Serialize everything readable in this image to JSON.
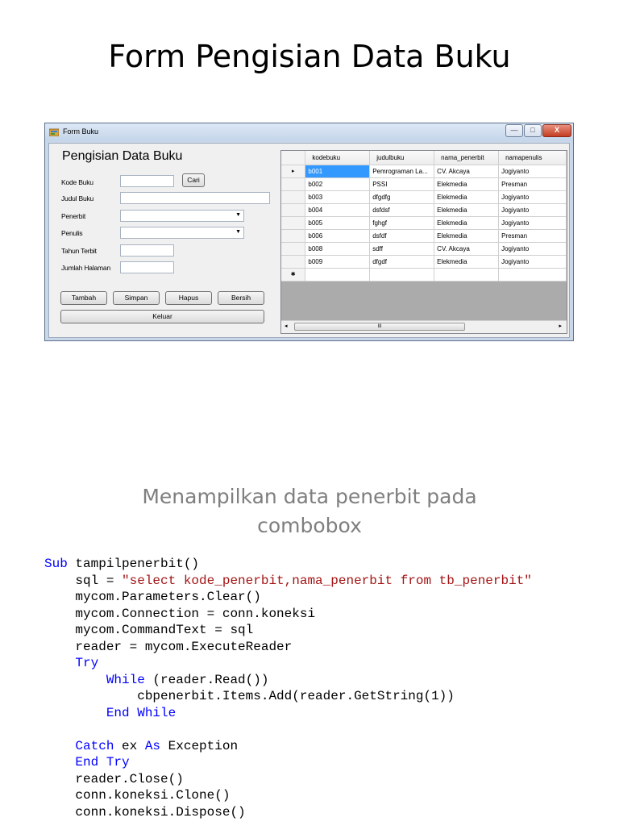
{
  "slide": {
    "title": "Form Pengisian Data Buku",
    "subtitle_line1": "Menampilkan data penerbit pada",
    "subtitle_line2": "combobox"
  },
  "window": {
    "title": "Form Buku",
    "controls": {
      "minimize": "—",
      "maximize": "□",
      "close": "X"
    }
  },
  "form": {
    "heading": "Pengisian Data Buku",
    "labels": {
      "kode_buku": "Kode Buku",
      "judul_buku": "Judul Buku",
      "penerbit": "Penerbit",
      "penulis": "Penulis",
      "tahun_terbit": "Tahun Terbit",
      "jumlah_halaman": "Jumlah Halaman"
    },
    "values": {
      "kode_buku": "",
      "judul_buku": "",
      "penerbit": "",
      "penulis": "",
      "tahun_terbit": "",
      "jumlah_halaman": ""
    },
    "buttons": {
      "cari": "Cari",
      "tambah": "Tambah",
      "simpan": "Simpan",
      "hapus": "Hapus",
      "bersih": "Bersih",
      "keluar": "Keluar"
    }
  },
  "grid": {
    "columns": [
      "kodebuku",
      "judulbuku",
      "nama_penerbit",
      "namapenulis"
    ],
    "rows": [
      [
        "b001",
        "Pemrograman La...",
        "CV. Akcaya",
        "Jogiyanto"
      ],
      [
        "b002",
        "PSSI",
        "Elekmedia",
        "Presman"
      ],
      [
        "b003",
        "dfgdfg",
        "Elekmedia",
        "Jogiyanto"
      ],
      [
        "b004",
        "dsfdsf",
        "Elekmedia",
        "Jogiyanto"
      ],
      [
        "b005",
        "fghgf",
        "Elekmedia",
        "Jogiyanto"
      ],
      [
        "b006",
        "dsfdf",
        "Elekmedia",
        "Presman"
      ],
      [
        "b008",
        "sdff",
        "CV. Akcaya",
        "Jogiyanto"
      ],
      [
        "b009",
        "dfgdf",
        "Elekmedia",
        "Jogiyanto"
      ]
    ],
    "current_row_marker": "▸",
    "new_row_marker": "✱",
    "scrollbar_grip": "III"
  },
  "code_lines": [
    [
      {
        "t": "Sub ",
        "k": "kw"
      },
      {
        "t": "tampilpenerbit()",
        "k": ""
      }
    ],
    [
      {
        "t": "    sql = ",
        "k": ""
      },
      {
        "t": "\"select kode_penerbit,nama_penerbit from tb_penerbit\"",
        "k": "str"
      }
    ],
    [
      {
        "t": "    mycom.Parameters.Clear()",
        "k": ""
      }
    ],
    [
      {
        "t": "    mycom.Connection = conn.koneksi",
        "k": ""
      }
    ],
    [
      {
        "t": "    mycom.CommandText = sql",
        "k": ""
      }
    ],
    [
      {
        "t": "    reader = mycom.ExecuteReader",
        "k": ""
      }
    ],
    [
      {
        "t": "    Try",
        "k": "kw"
      }
    ],
    [
      {
        "t": "        ",
        "k": ""
      },
      {
        "t": "While",
        "k": "kw"
      },
      {
        "t": " (reader.Read())",
        "k": ""
      }
    ],
    [
      {
        "t": "            cbpenerbit.Items.Add(reader.GetString(1))",
        "k": ""
      }
    ],
    [
      {
        "t": "        ",
        "k": ""
      },
      {
        "t": "End While",
        "k": "kw"
      }
    ],
    [
      {
        "t": "",
        "k": ""
      }
    ],
    [
      {
        "t": "    ",
        "k": ""
      },
      {
        "t": "Catch",
        "k": "kw"
      },
      {
        "t": " ex ",
        "k": ""
      },
      {
        "t": "As",
        "k": "kw"
      },
      {
        "t": " Exception",
        "k": ""
      }
    ],
    [
      {
        "t": "    ",
        "k": ""
      },
      {
        "t": "End Try",
        "k": "kw"
      }
    ],
    [
      {
        "t": "    reader.Close()",
        "k": ""
      }
    ],
    [
      {
        "t": "    conn.koneksi.Clone()",
        "k": ""
      }
    ],
    [
      {
        "t": "    conn.koneksi.Dispose()",
        "k": ""
      }
    ]
  ],
  "colors": {
    "keyword": "#0000ff",
    "string": "#a31515",
    "selection": "#3399ff",
    "subtitle": "#7f7f7f"
  }
}
